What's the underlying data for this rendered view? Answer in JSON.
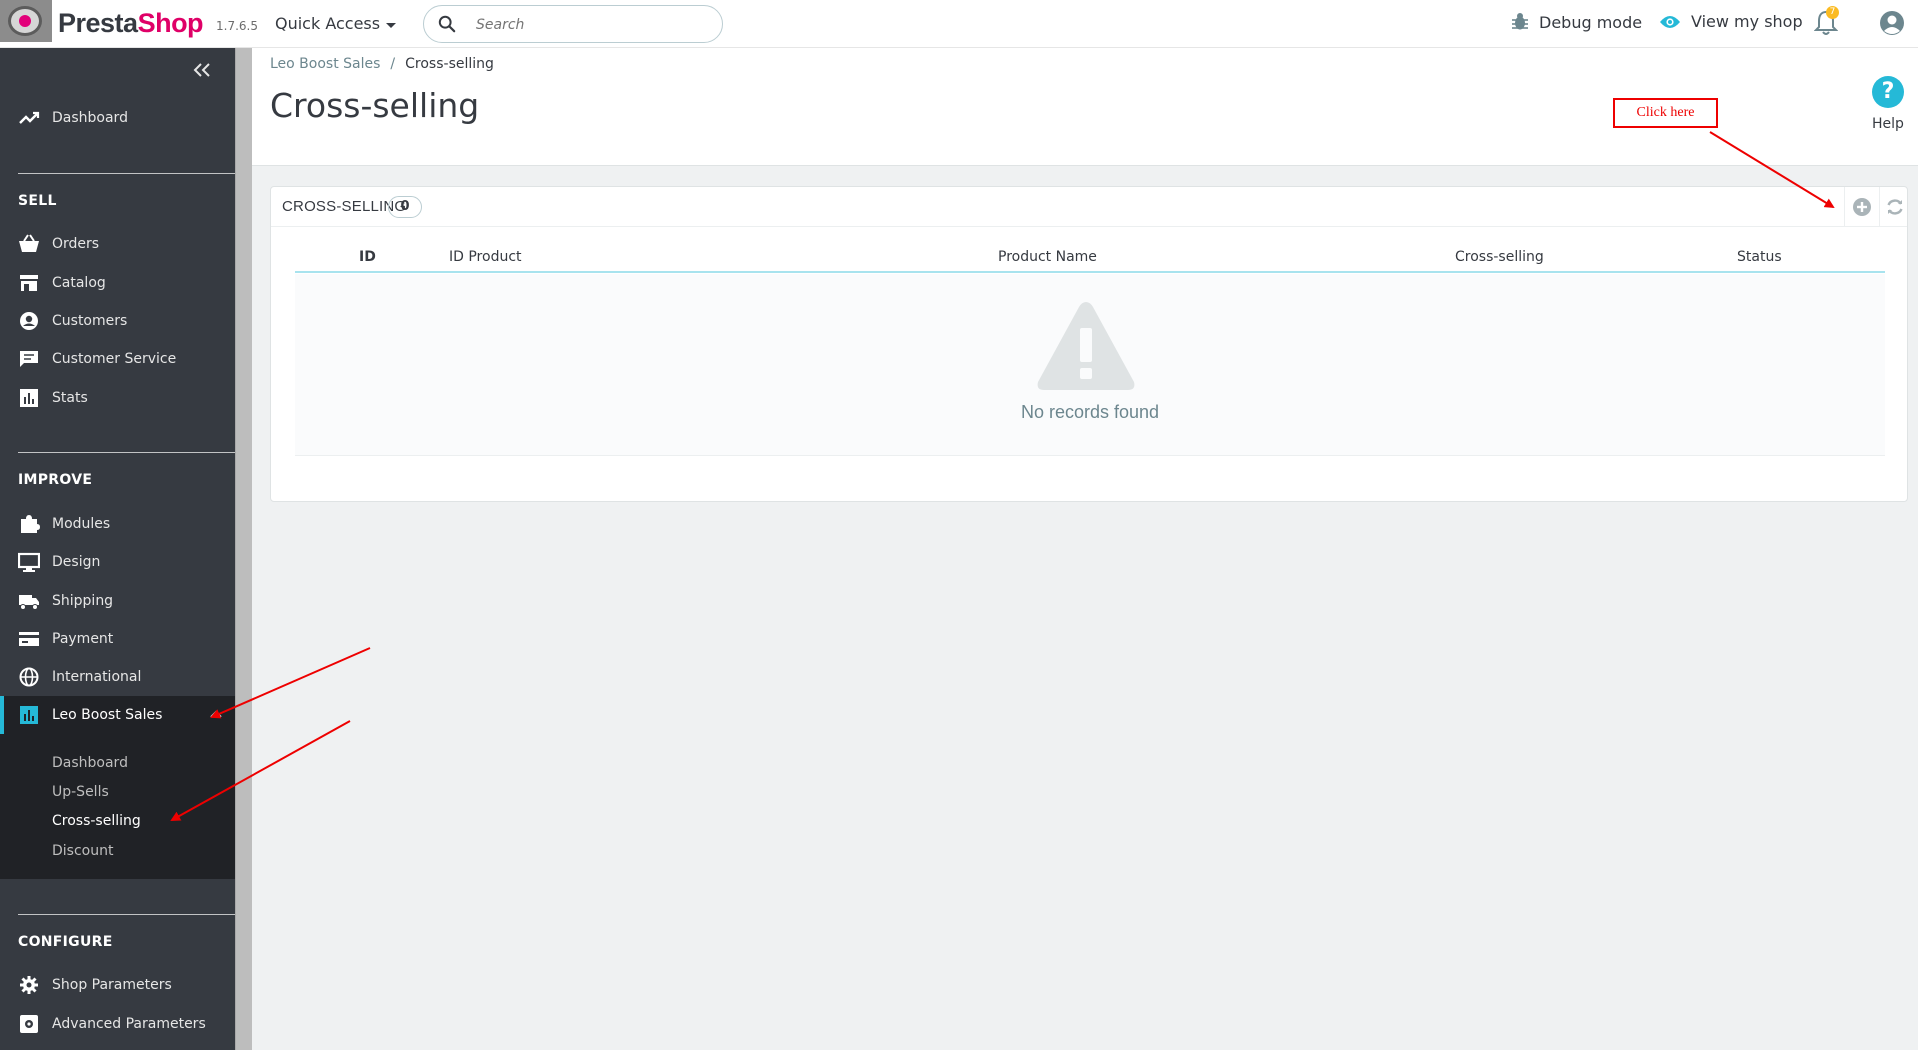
{
  "header": {
    "brand_first": "Presta",
    "brand_second": "Shop",
    "version": "1.7.6.5",
    "quick_access": "Quick Access",
    "search_placeholder": "Search",
    "debug_mode": "Debug mode",
    "view_shop": "View my shop",
    "notification_count": "7",
    "accent_color": "#25b9d7",
    "brand_color": "#df0067"
  },
  "sidebar": {
    "dashboard": "Dashboard",
    "sell_title": "SELL",
    "sell_items": [
      "Orders",
      "Catalog",
      "Customers",
      "Customer Service",
      "Stats"
    ],
    "improve_title": "IMPROVE",
    "improve_items": [
      "Modules",
      "Design",
      "Shipping",
      "Payment",
      "International"
    ],
    "active_item": "Leo Boost Sales",
    "sub_items": [
      "Dashboard",
      "Up-Sells",
      "Cross-selling",
      "Discount"
    ],
    "configure_title": "CONFIGURE",
    "configure_items": [
      "Shop Parameters",
      "Advanced Parameters"
    ]
  },
  "breadcrumb": {
    "parent": "Leo Boost Sales",
    "separator": "/",
    "current": "Cross-selling"
  },
  "page": {
    "title": "Cross-selling",
    "help": "Help"
  },
  "panel": {
    "title": "CROSS-SELLING",
    "count": "0",
    "columns": [
      "ID",
      "ID Product",
      "Product Name",
      "Cross-selling",
      "Status"
    ],
    "empty_message": "No records found"
  },
  "annotation": {
    "callout": "Click here",
    "color": "#e00000"
  }
}
